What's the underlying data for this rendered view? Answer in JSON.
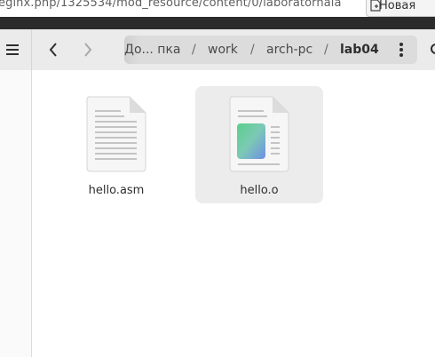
{
  "browser": {
    "url_fragment": "eginx.php/1325534/mod_resource/content/0/laboratornaia",
    "new_tab_label": "Новая"
  },
  "toolbar": {
    "menu_icon": "hamburger-menu-icon",
    "back_icon": "chevron-left-icon",
    "forward_icon": "chevron-right-icon",
    "more_icon": "vertical-dots-icon"
  },
  "breadcrumb": {
    "items": [
      "До... пка",
      "work",
      "arch-pc",
      "lab04"
    ],
    "separator": "/"
  },
  "files": [
    {
      "name": "hello.asm",
      "icon": "text-file-icon",
      "selected": false
    },
    {
      "name": "hello.o",
      "icon": "object-file-icon",
      "selected": true
    }
  ],
  "colors": {
    "header_bg": "#ebebeb",
    "pathbar_bg": "#dcdcdc",
    "selection_bg": "#ececec"
  }
}
